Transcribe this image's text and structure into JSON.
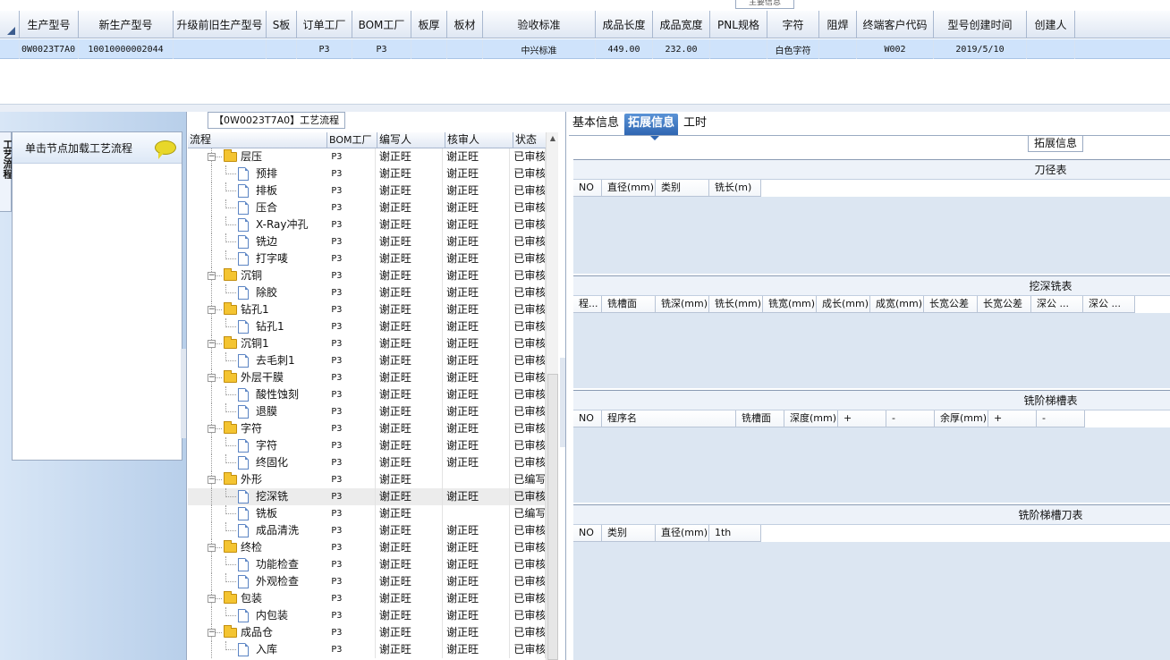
{
  "top_grid": {
    "columns": [
      {
        "label": "生产型号",
        "w": 66
      },
      {
        "label": "新生产型号",
        "w": 106
      },
      {
        "label": "升级前旧生产型号",
        "w": 104
      },
      {
        "label": "S板",
        "w": 34
      },
      {
        "label": "订单工厂",
        "w": 62
      },
      {
        "label": "BOM工厂",
        "w": 66
      },
      {
        "label": "板厚",
        "w": 40
      },
      {
        "label": "材",
        "w": 40,
        "pre": "板"
      },
      {
        "label": "验收标准",
        "w": 126
      },
      {
        "label": "成品长度",
        "w": 64
      },
      {
        "label": "成品宽度",
        "w": 64
      },
      {
        "label": "PNL规格",
        "w": 64
      },
      {
        "label": "字符",
        "w": 58
      },
      {
        "label": "阻焊",
        "w": 42
      },
      {
        "label": "终端客户代码",
        "w": 86
      },
      {
        "label": "型号创建时间",
        "w": 104
      },
      {
        "label": "创建人",
        "w": 54
      }
    ],
    "row": [
      "0W0023T7A0",
      "10010000002044",
      "",
      "",
      "P3",
      "P3",
      "",
      "",
      "中兴标准",
      "449.00",
      "232.00",
      "",
      "白色字符",
      "",
      "W002",
      "2019/5/10",
      ""
    ],
    "top_tab": "主要信息"
  },
  "left_panel": {
    "vertical_tab": "工艺流程",
    "hint": "单击节点加载工艺流程"
  },
  "process_flow": {
    "group_title": "【0W0023T7A0】工艺流程",
    "columns": [
      "流程",
      "BOM工厂",
      "编写人",
      "核审人",
      "状态"
    ],
    "rows": [
      {
        "level": 0,
        "name": "层压",
        "bom": "P3",
        "writer": "谢正旺",
        "reviewer": "谢正旺",
        "status": "已审核"
      },
      {
        "level": 1,
        "name": "预排",
        "bom": "P3",
        "writer": "谢正旺",
        "reviewer": "谢正旺",
        "status": "已审核"
      },
      {
        "level": 1,
        "name": "排板",
        "bom": "P3",
        "writer": "谢正旺",
        "reviewer": "谢正旺",
        "status": "已审核"
      },
      {
        "level": 1,
        "name": "压合",
        "bom": "P3",
        "writer": "谢正旺",
        "reviewer": "谢正旺",
        "status": "已审核"
      },
      {
        "level": 1,
        "name": "X-Ray冲孔",
        "bom": "P3",
        "writer": "谢正旺",
        "reviewer": "谢正旺",
        "status": "已审核"
      },
      {
        "level": 1,
        "name": "铣边",
        "bom": "P3",
        "writer": "谢正旺",
        "reviewer": "谢正旺",
        "status": "已审核"
      },
      {
        "level": 1,
        "name": "打字唛",
        "bom": "P3",
        "writer": "谢正旺",
        "reviewer": "谢正旺",
        "status": "已审核"
      },
      {
        "level": 0,
        "name": "沉铜",
        "bom": "P3",
        "writer": "谢正旺",
        "reviewer": "谢正旺",
        "status": "已审核"
      },
      {
        "level": 1,
        "name": "除胶",
        "bom": "P3",
        "writer": "谢正旺",
        "reviewer": "谢正旺",
        "status": "已审核"
      },
      {
        "level": 0,
        "name": "钻孔1",
        "bom": "P3",
        "writer": "谢正旺",
        "reviewer": "谢正旺",
        "status": "已审核"
      },
      {
        "level": 1,
        "name": "钻孔1",
        "bom": "P3",
        "writer": "谢正旺",
        "reviewer": "谢正旺",
        "status": "已审核"
      },
      {
        "level": 0,
        "name": "沉铜1",
        "bom": "P3",
        "writer": "谢正旺",
        "reviewer": "谢正旺",
        "status": "已审核"
      },
      {
        "level": 1,
        "name": "去毛刺1",
        "bom": "P3",
        "writer": "谢正旺",
        "reviewer": "谢正旺",
        "status": "已审核"
      },
      {
        "level": 0,
        "name": "外层干膜",
        "bom": "P3",
        "writer": "谢正旺",
        "reviewer": "谢正旺",
        "status": "已审核"
      },
      {
        "level": 1,
        "name": "酸性蚀刻",
        "bom": "P3",
        "writer": "谢正旺",
        "reviewer": "谢正旺",
        "status": "已审核"
      },
      {
        "level": 1,
        "name": "退膜",
        "bom": "P3",
        "writer": "谢正旺",
        "reviewer": "谢正旺",
        "status": "已审核"
      },
      {
        "level": 0,
        "name": "字符",
        "bom": "P3",
        "writer": "谢正旺",
        "reviewer": "谢正旺",
        "status": "已审核"
      },
      {
        "level": 1,
        "name": "字符",
        "bom": "P3",
        "writer": "谢正旺",
        "reviewer": "谢正旺",
        "status": "已审核"
      },
      {
        "level": 1,
        "name": "终固化",
        "bom": "P3",
        "writer": "谢正旺",
        "reviewer": "谢正旺",
        "status": "已审核"
      },
      {
        "level": 0,
        "name": "外形",
        "bom": "P3",
        "writer": "谢正旺",
        "reviewer": "",
        "status": "已编写"
      },
      {
        "level": 1,
        "name": "挖深铣",
        "bom": "P3",
        "writer": "谢正旺",
        "reviewer": "谢正旺",
        "status": "已审核",
        "selected": true
      },
      {
        "level": 1,
        "name": "铣板",
        "bom": "P3",
        "writer": "谢正旺",
        "reviewer": "",
        "status": "已编写"
      },
      {
        "level": 1,
        "name": "成品清洗",
        "bom": "P3",
        "writer": "谢正旺",
        "reviewer": "谢正旺",
        "status": "已审核"
      },
      {
        "level": 0,
        "name": "终检",
        "bom": "P3",
        "writer": "谢正旺",
        "reviewer": "谢正旺",
        "status": "已审核"
      },
      {
        "level": 1,
        "name": "功能检查",
        "bom": "P3",
        "writer": "谢正旺",
        "reviewer": "谢正旺",
        "status": "已审核"
      },
      {
        "level": 1,
        "name": "外观检查",
        "bom": "P3",
        "writer": "谢正旺",
        "reviewer": "谢正旺",
        "status": "已审核"
      },
      {
        "level": 0,
        "name": "包装",
        "bom": "P3",
        "writer": "谢正旺",
        "reviewer": "谢正旺",
        "status": "已审核"
      },
      {
        "level": 1,
        "name": "内包装",
        "bom": "P3",
        "writer": "谢正旺",
        "reviewer": "谢正旺",
        "status": "已审核"
      },
      {
        "level": 0,
        "name": "成品仓",
        "bom": "P3",
        "writer": "谢正旺",
        "reviewer": "谢正旺",
        "status": "已审核"
      },
      {
        "level": 1,
        "name": "入库",
        "bom": "P3",
        "writer": "谢正旺",
        "reviewer": "谢正旺",
        "status": "已审核"
      }
    ]
  },
  "right_panel": {
    "tabs": [
      {
        "label": "基本信息",
        "active": false
      },
      {
        "label": "拓展信息",
        "active": true
      },
      {
        "label": "工时",
        "active": false
      }
    ],
    "group_title": "拓展信息",
    "sections": [
      {
        "title": "刀径表",
        "columns": [
          {
            "label": "NO",
            "w": 32
          },
          {
            "label": "直径(mm)",
            "w": 60
          },
          {
            "label": "类别",
            "w": 60
          },
          {
            "label": "铣长(m)",
            "w": 58
          }
        ]
      },
      {
        "title": "挖深铣表",
        "columns": [
          {
            "label": "程...",
            "w": 32
          },
          {
            "label": "铣槽面",
            "w": 60
          },
          {
            "label": "铣深(mm)",
            "w": 60
          },
          {
            "label": "铣长(mm)",
            "w": 60
          },
          {
            "label": "铣宽(mm)",
            "w": 60
          },
          {
            "label": "成长(mm)",
            "w": 60
          },
          {
            "label": "成宽(mm)",
            "w": 60
          },
          {
            "label": "长宽公差",
            "w": 60
          },
          {
            "label": "长宽公差",
            "w": 60
          },
          {
            "label": "深公 ...",
            "w": 58
          },
          {
            "label": "深公 ...",
            "w": 58
          }
        ]
      },
      {
        "title": "铣阶梯槽表",
        "columns": [
          {
            "label": "NO",
            "w": 32
          },
          {
            "label": "程序名",
            "w": 150
          },
          {
            "label": "铣槽面",
            "w": 54
          },
          {
            "label": "深度(mm)",
            "w": 60
          },
          {
            "label": "+",
            "w": 54
          },
          {
            "label": "-",
            "w": 54
          },
          {
            "label": "余厚(mm)",
            "w": 60
          },
          {
            "label": "+",
            "w": 54
          },
          {
            "label": "-",
            "w": 54
          }
        ]
      },
      {
        "title": "铣阶梯槽刀表",
        "columns": [
          {
            "label": "NO",
            "w": 32
          },
          {
            "label": "类别",
            "w": 60
          },
          {
            "label": "直径(mm)",
            "w": 60
          },
          {
            "label": "1th",
            "w": 58
          }
        ]
      }
    ]
  }
}
